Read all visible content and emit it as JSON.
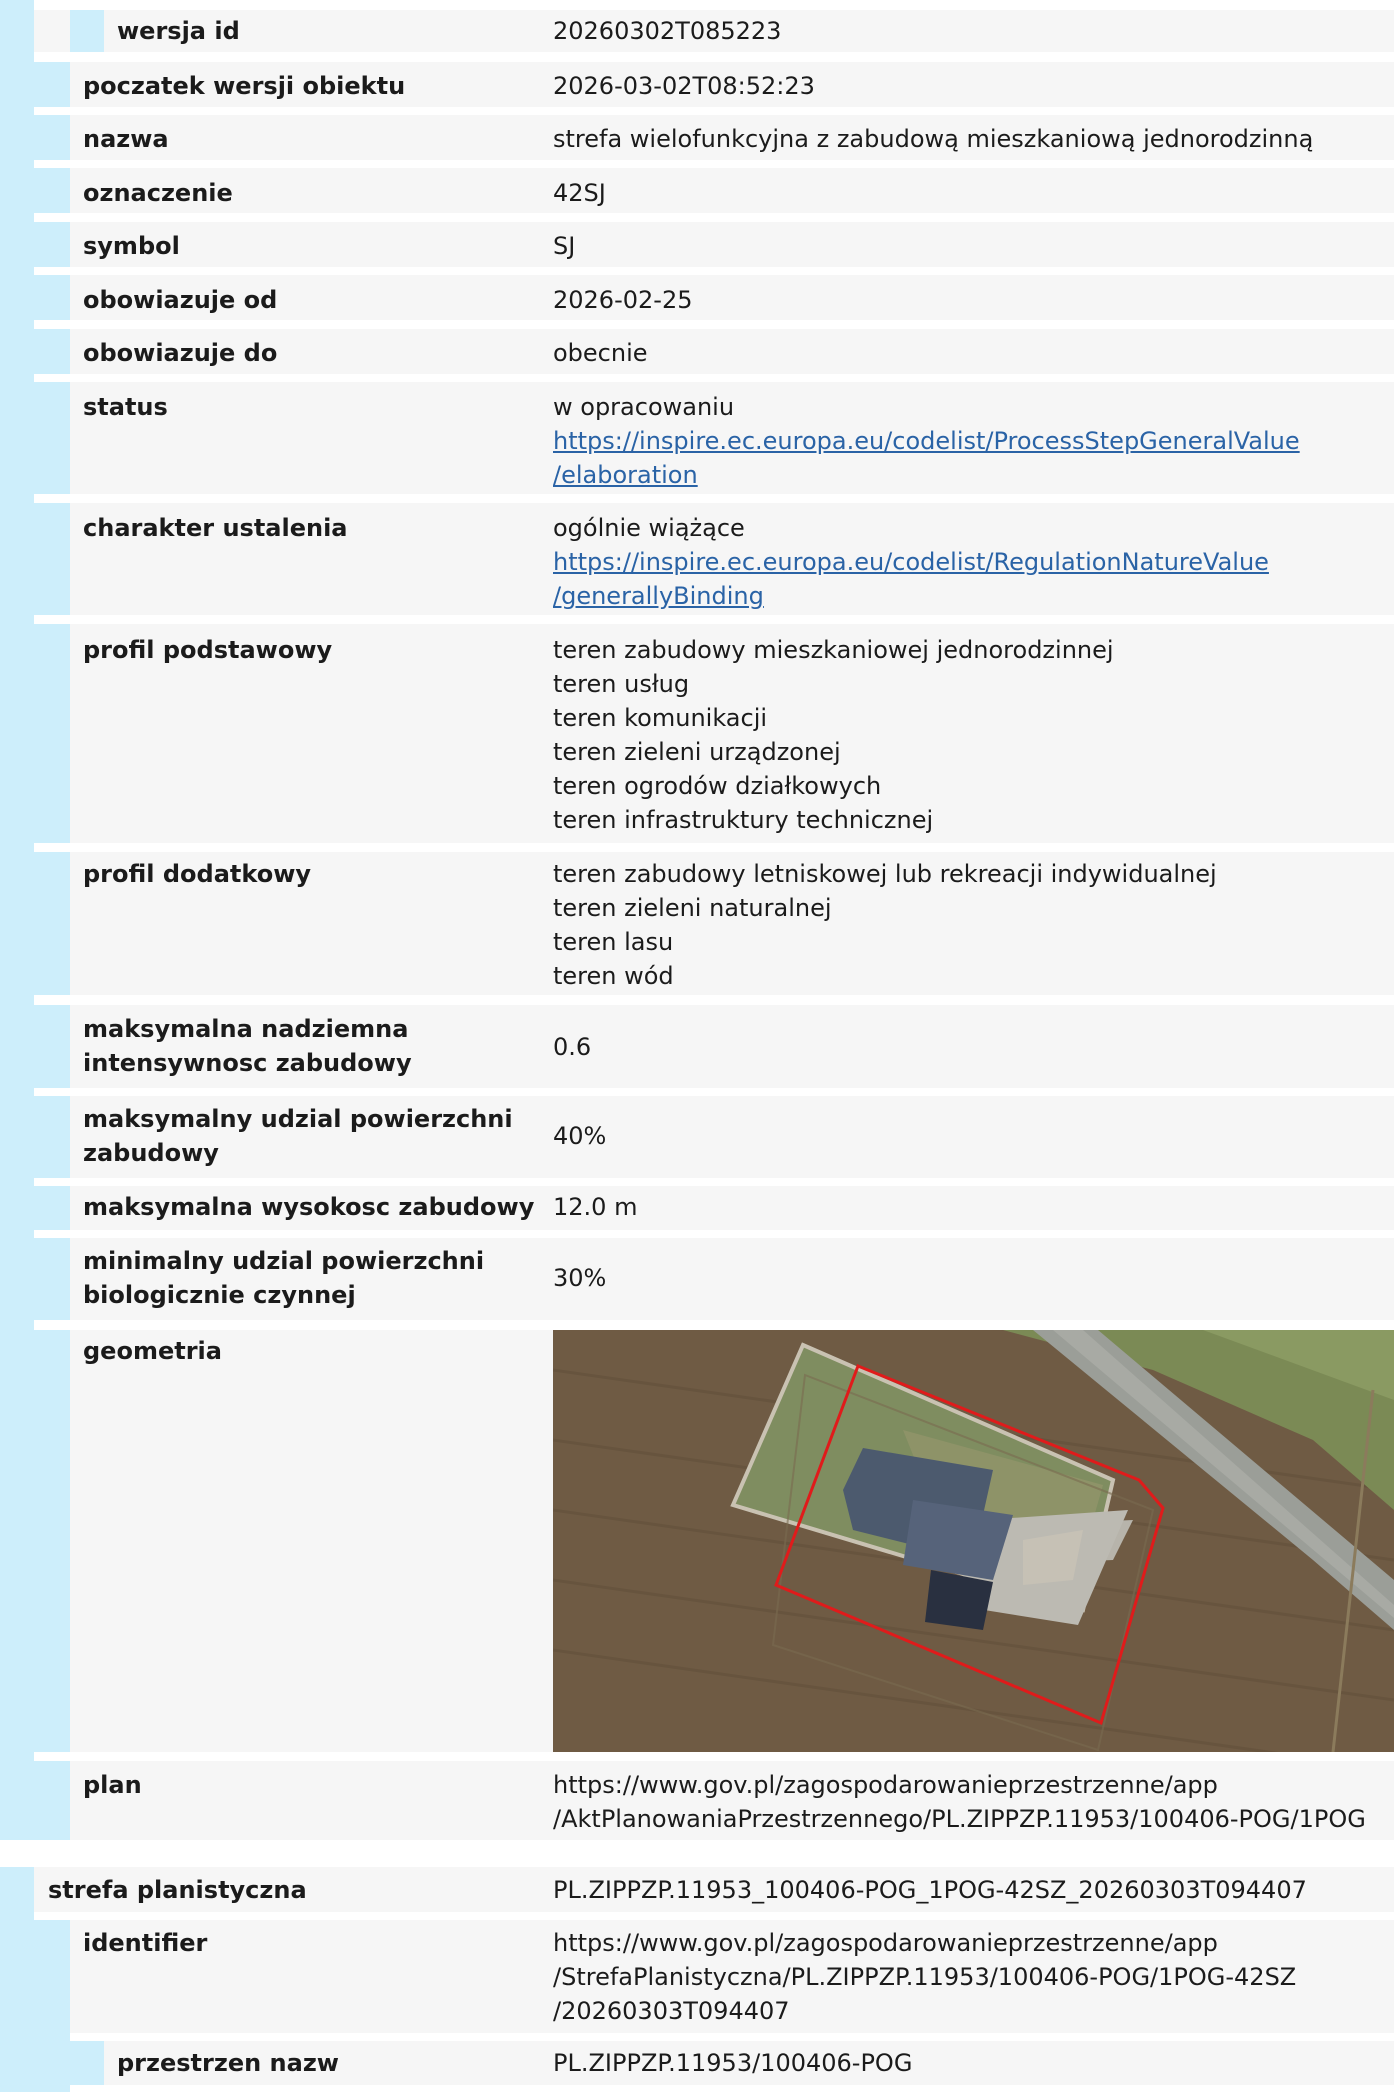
{
  "block1": {
    "rows": [
      {
        "label": "wersja id",
        "value": "20260302T085223"
      },
      {
        "label": "poczatek wersji obiektu",
        "value": "2026-03-02T08:52:23"
      },
      {
        "label": "nazwa",
        "value": "strefa wielofunkcyjna z zabudową mieszkaniową jednorodzinną"
      },
      {
        "label": "oznaczenie",
        "value": "42SJ"
      },
      {
        "label": "symbol",
        "value": "SJ"
      },
      {
        "label": "obowiazuje od",
        "value": "2026-02-25"
      },
      {
        "label": "obowiazuje do",
        "value": "obecnie"
      }
    ],
    "status": {
      "label": "status",
      "text": "w opracowaniu",
      "link_line1": "https://inspire.ec.europa.eu/codelist/ProcessStepGeneralValue",
      "link_line2": "/elaboration"
    },
    "charakter": {
      "label": "charakter ustalenia",
      "text": "ogólnie wiążące",
      "link_line1": "https://inspire.ec.europa.eu/codelist/RegulationNatureValue",
      "link_line2": "/generallyBinding"
    },
    "profil_podstawowy": {
      "label": "profil podstawowy",
      "items": [
        "teren zabudowy mieszkaniowej jednorodzinnej",
        "teren usług",
        "teren komunikacji",
        "teren zieleni urządzonej",
        "teren ogrodów działkowych",
        "teren infrastruktury technicznej"
      ]
    },
    "profil_dodatkowy": {
      "label": "profil dodatkowy",
      "items": [
        "teren zabudowy letniskowej lub rekreacji indywidualnej",
        "teren zieleni naturalnej",
        "teren lasu",
        "teren wód"
      ]
    },
    "intensywnosc": {
      "label_line1": "maksymalna nadziemna",
      "label_line2": "intensywnosc zabudowy",
      "value": "0.6"
    },
    "udzial": {
      "label_line1": "maksymalny udzial powierzchni",
      "label_line2": "zabudowy",
      "value": "40%"
    },
    "wysokosc": {
      "label": "maksymalna wysokosc zabudowy",
      "value": "12.0 m"
    },
    "biologiczna": {
      "label_line1": "minimalny udzial powierzchni",
      "label_line2": "biologicznie czynnej",
      "value": "30%"
    },
    "geometria": {
      "label": "geometria",
      "image": "aerial-photo-parcel-outline",
      "outline_color": "#e01b1b"
    },
    "plan": {
      "label": "plan",
      "line1": "https://www.gov.pl/zagospodarowanieprzestrzenne/app",
      "line2": "/AktPlanowaniaPrzestrzennego/PL.ZIPPZP.11953/100406-POG/1POG"
    }
  },
  "block2": {
    "header": {
      "label": "strefa planistyczna",
      "value": "PL.ZIPPZP.11953_100406-POG_1POG-42SZ_20260303T094407"
    },
    "identifier": {
      "label": "identifier",
      "line1": "https://www.gov.pl/zagospodarowanieprzestrzenne/app",
      "line2": "/StrefaPlanistyczna/PL.ZIPPZP.11953/100406-POG/1POG-42SZ",
      "line3": "/20260303T094407"
    },
    "przestrzen": {
      "label": "przestrzen nazw",
      "value": "PL.ZIPPZP.11953/100406-POG"
    }
  },
  "colors": {
    "accent": "#cdeefb",
    "row_bg": "#f6f6f6",
    "link": "#2a63a6"
  }
}
